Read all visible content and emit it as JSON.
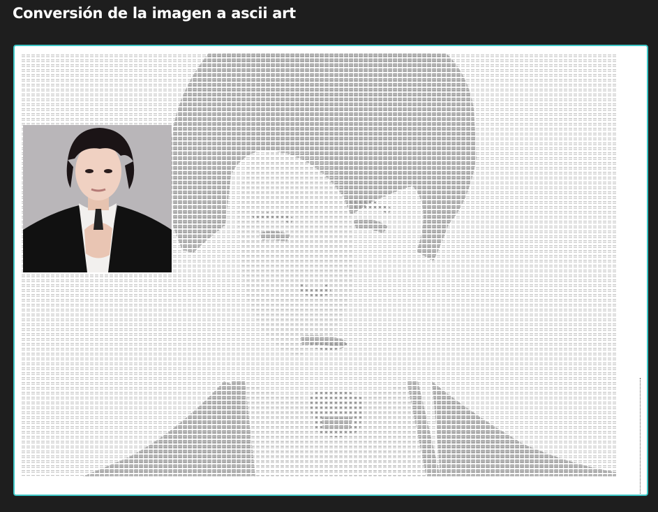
{
  "page": {
    "title": "Conversión de la imagen a ascii art"
  },
  "colors": {
    "background": "#1e1e1e",
    "panel_border": "#3ec7c7",
    "panel_background": "#ffffff",
    "ascii_light": "#c4c4c4",
    "ascii_dark": "#a2a2a2"
  },
  "source_image": {
    "description_icon": "portrait-photo"
  }
}
